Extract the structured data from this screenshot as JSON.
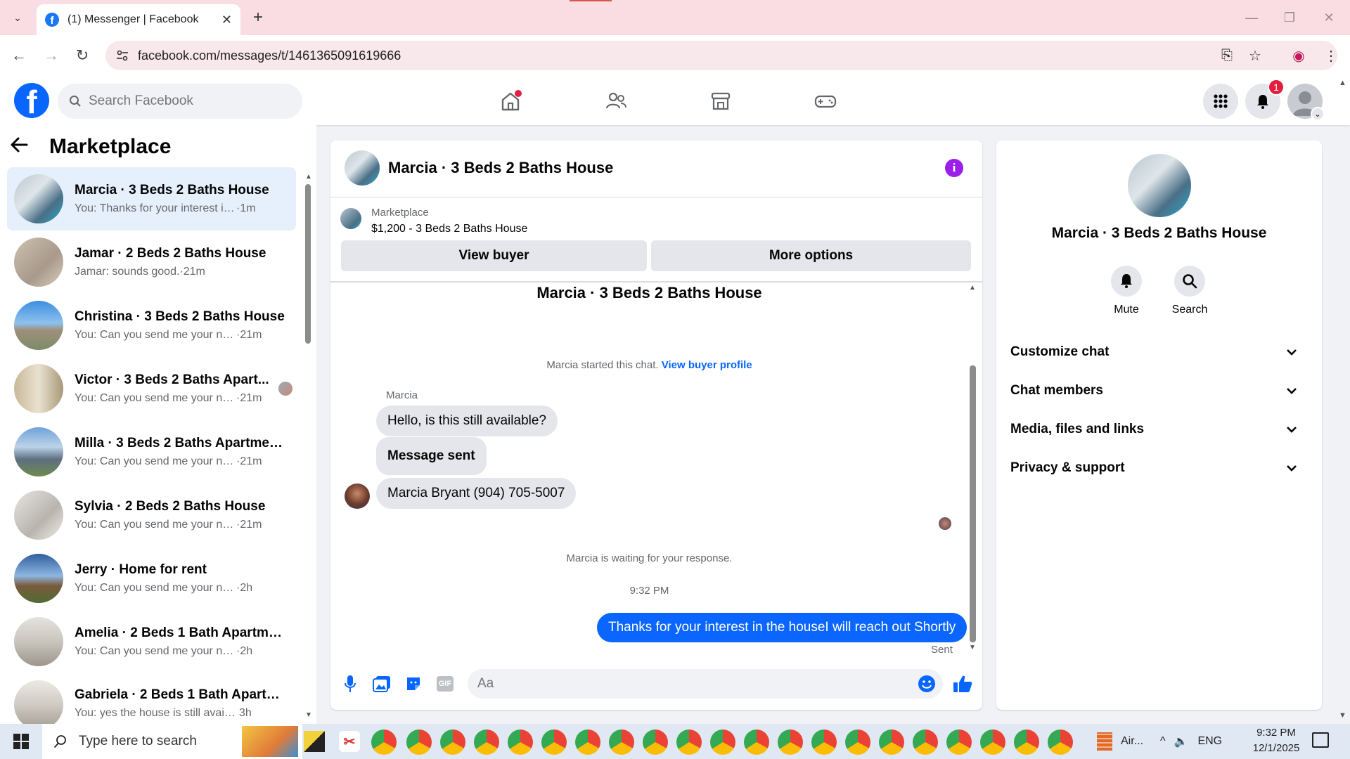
{
  "browser": {
    "tab_title": "(1) Messenger | Facebook",
    "url": "facebook.com/messages/t/1461365091619666",
    "new_tab": "+",
    "close_tab": "✕"
  },
  "fb_header": {
    "search_placeholder": "Search Facebook",
    "notification_count": "1"
  },
  "left": {
    "title": "Marketplace",
    "conversations": [
      {
        "name": "Marcia · 3 Beds 2 Baths House",
        "preview": "You: Thanks for your interest in the...",
        "time": "·1m"
      },
      {
        "name": "Jamar · 2 Beds 2 Baths House",
        "preview": "Jamar: sounds good.",
        "time": "·21m"
      },
      {
        "name": "Christina · 3 Beds 2 Baths House",
        "preview": "You: Can you send me your num...",
        "time": "·21m"
      },
      {
        "name": "Victor · 3 Beds 2 Baths Apart...",
        "preview": "You: Can you send me your nu...",
        "time": "·21m"
      },
      {
        "name": "Milla · 3 Beds 2 Baths Apartmen...",
        "preview": "You: Can you send me your num...",
        "time": "·21m"
      },
      {
        "name": "Sylvia · 2 Beds 2 Baths House",
        "preview": "You: Can you send me your num...",
        "time": "·21m"
      },
      {
        "name": "Jerry · Home for rent",
        "preview": "You: Can you send me your numbe...",
        "time": "·2h"
      },
      {
        "name": "Amelia · 2 Beds 1 Bath Apartme...",
        "preview": "You: Can you send me your numbe...",
        "time": "·2h"
      },
      {
        "name": "Gabriela · 2 Beds 1 Bath Apartm...",
        "preview": "You: yes the house is still available f...",
        "time": "3h"
      }
    ]
  },
  "chat": {
    "title": "Marcia · 3 Beds 2 Baths House",
    "marketplace_label": "Marketplace",
    "listing": "$1,200 - 3 Beds 2 Baths House",
    "view_buyer": "View buyer",
    "more_options": "More options",
    "conv_title": "Marcia · 3 Beds 2 Baths House",
    "started_text": "Marcia started this chat.",
    "view_buyer_profile": "View buyer profile",
    "sender_name": "Marcia",
    "msg1": "Hello, is this still available?",
    "msg2": "Message sent",
    "msg3": "Marcia Bryant (904) 705-5007",
    "waiting": "Marcia is waiting for your response.",
    "timestamp": "9:32 PM",
    "outgoing": "Thanks for your interest in the houseI will reach out Shortly",
    "status": "Sent",
    "compose_placeholder": "Aa"
  },
  "right": {
    "name": "Marcia · 3 Beds 2 Baths House",
    "mute": "Mute",
    "search": "Search",
    "sections": [
      "Customize chat",
      "Chat members",
      "Media, files and links",
      "Privacy & support"
    ]
  },
  "taskbar": {
    "search_placeholder": "Type here to search",
    "app_label": "Air...",
    "lang": "ENG",
    "time": "9:32 PM",
    "date": "12/1/2025"
  },
  "colors": {
    "fb_blue": "#0866ff",
    "active_row": "#e6f0fc",
    "outgoing_bubble": "#0a66ff",
    "info_purple": "#9b1fe8",
    "badge_red": "#e41e3f"
  }
}
